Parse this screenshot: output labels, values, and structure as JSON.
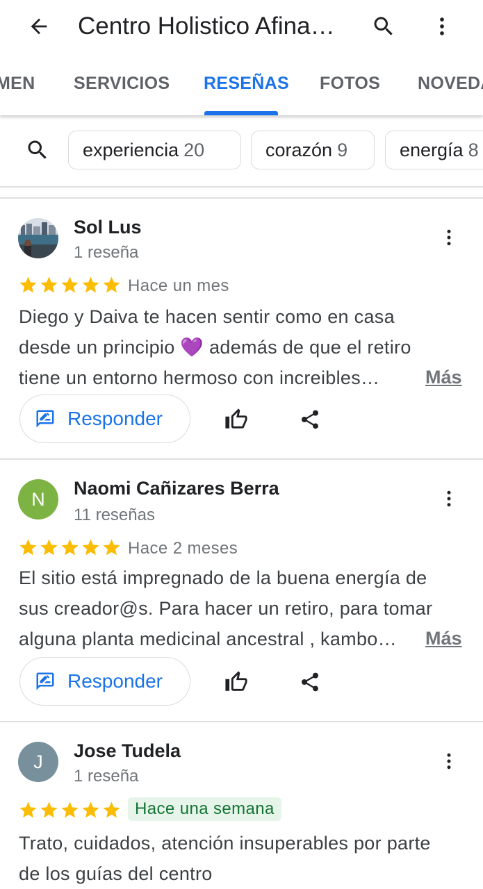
{
  "header": {
    "title": "Centro Holistico Afina…",
    "back_icon": "arrow-back-icon",
    "search_icon": "search-icon",
    "more_icon": "more-vert-icon"
  },
  "tabs": [
    {
      "label": "MEN"
    },
    {
      "label": "SERVICIOS"
    },
    {
      "label": "RESEÑAS",
      "active": true
    },
    {
      "label": "FOTOS"
    },
    {
      "label": "NOVEDA"
    }
  ],
  "topic_chips": [
    {
      "label": "experiencia",
      "count": "20"
    },
    {
      "label": "corazón",
      "count": "9"
    },
    {
      "label": "energía",
      "count": "8"
    }
  ],
  "colors": {
    "accent": "#1a73e8",
    "star": "#fbbc04",
    "avatar_n": "#7cb342",
    "avatar_j": "#78909c",
    "badge_bg": "#e6f4ea",
    "badge_text": "#137333"
  },
  "reviews": [
    {
      "name": "Sol Lus",
      "count": "1 reseña",
      "rating": 5,
      "date": "Hace un mes",
      "text_lines": [
        "Diego y Daiva te hacen sentir como en casa",
        "desde un principio 💜 además de que el retiro",
        "tiene un entorno hermoso  con increibles…"
      ],
      "more_label": "Más",
      "reply_label": "Responder"
    },
    {
      "name": "Naomi Cañizares Berra",
      "initial": "N",
      "count": "11 reseñas",
      "rating": 5,
      "date": "Hace 2 meses",
      "text_lines": [
        "El sitio está impregnado de la buena energía de",
        "sus creador@s. Para hacer un retiro, para tomar",
        "alguna planta medicinal ancestral , kambo…"
      ],
      "more_label": "Más",
      "reply_label": "Responder"
    },
    {
      "name": "Jose Tudela",
      "initial": "J",
      "count": "1 reseña",
      "rating": 5,
      "date": "Hace una semana",
      "text_lines": [
        "Trato, cuidados, atención insuperables por parte",
        "de los guías del centro"
      ]
    }
  ]
}
